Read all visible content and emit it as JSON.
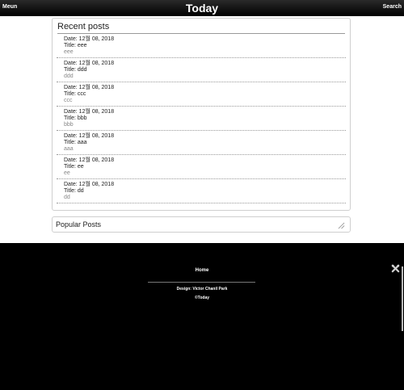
{
  "header": {
    "menu_label": "Meun",
    "title": "Today",
    "search_label": "Search"
  },
  "recent": {
    "heading": "Recent posts",
    "posts": [
      {
        "date": "Date: 12월 08, 2018",
        "title": "Title: eee",
        "body": "eee"
      },
      {
        "date": "Date: 12월 08, 2018",
        "title": "Title: ddd",
        "body": "ddd"
      },
      {
        "date": "Date: 12월 08, 2018",
        "title": "Title: ccc",
        "body": "ccc"
      },
      {
        "date": "Date: 12월 08, 2018",
        "title": "Title: bbb",
        "body": "bbb"
      },
      {
        "date": "Date: 12월 08, 2018",
        "title": "Title: aaa",
        "body": "aaa"
      },
      {
        "date": "Date: 12월 08, 2018",
        "title": "Title: ee",
        "body": "ee"
      },
      {
        "date": "Date: 12월 08, 2018",
        "title": "Title: dd",
        "body": "dd"
      }
    ]
  },
  "popular": {
    "label": "Popular Posts"
  },
  "footer": {
    "home_link": "Home",
    "design_credit": "Design: Victor Chanil Park",
    "copyright": "©Today"
  },
  "icons": {
    "resize": "resize-grip-icon",
    "tools": "tools-icon"
  }
}
